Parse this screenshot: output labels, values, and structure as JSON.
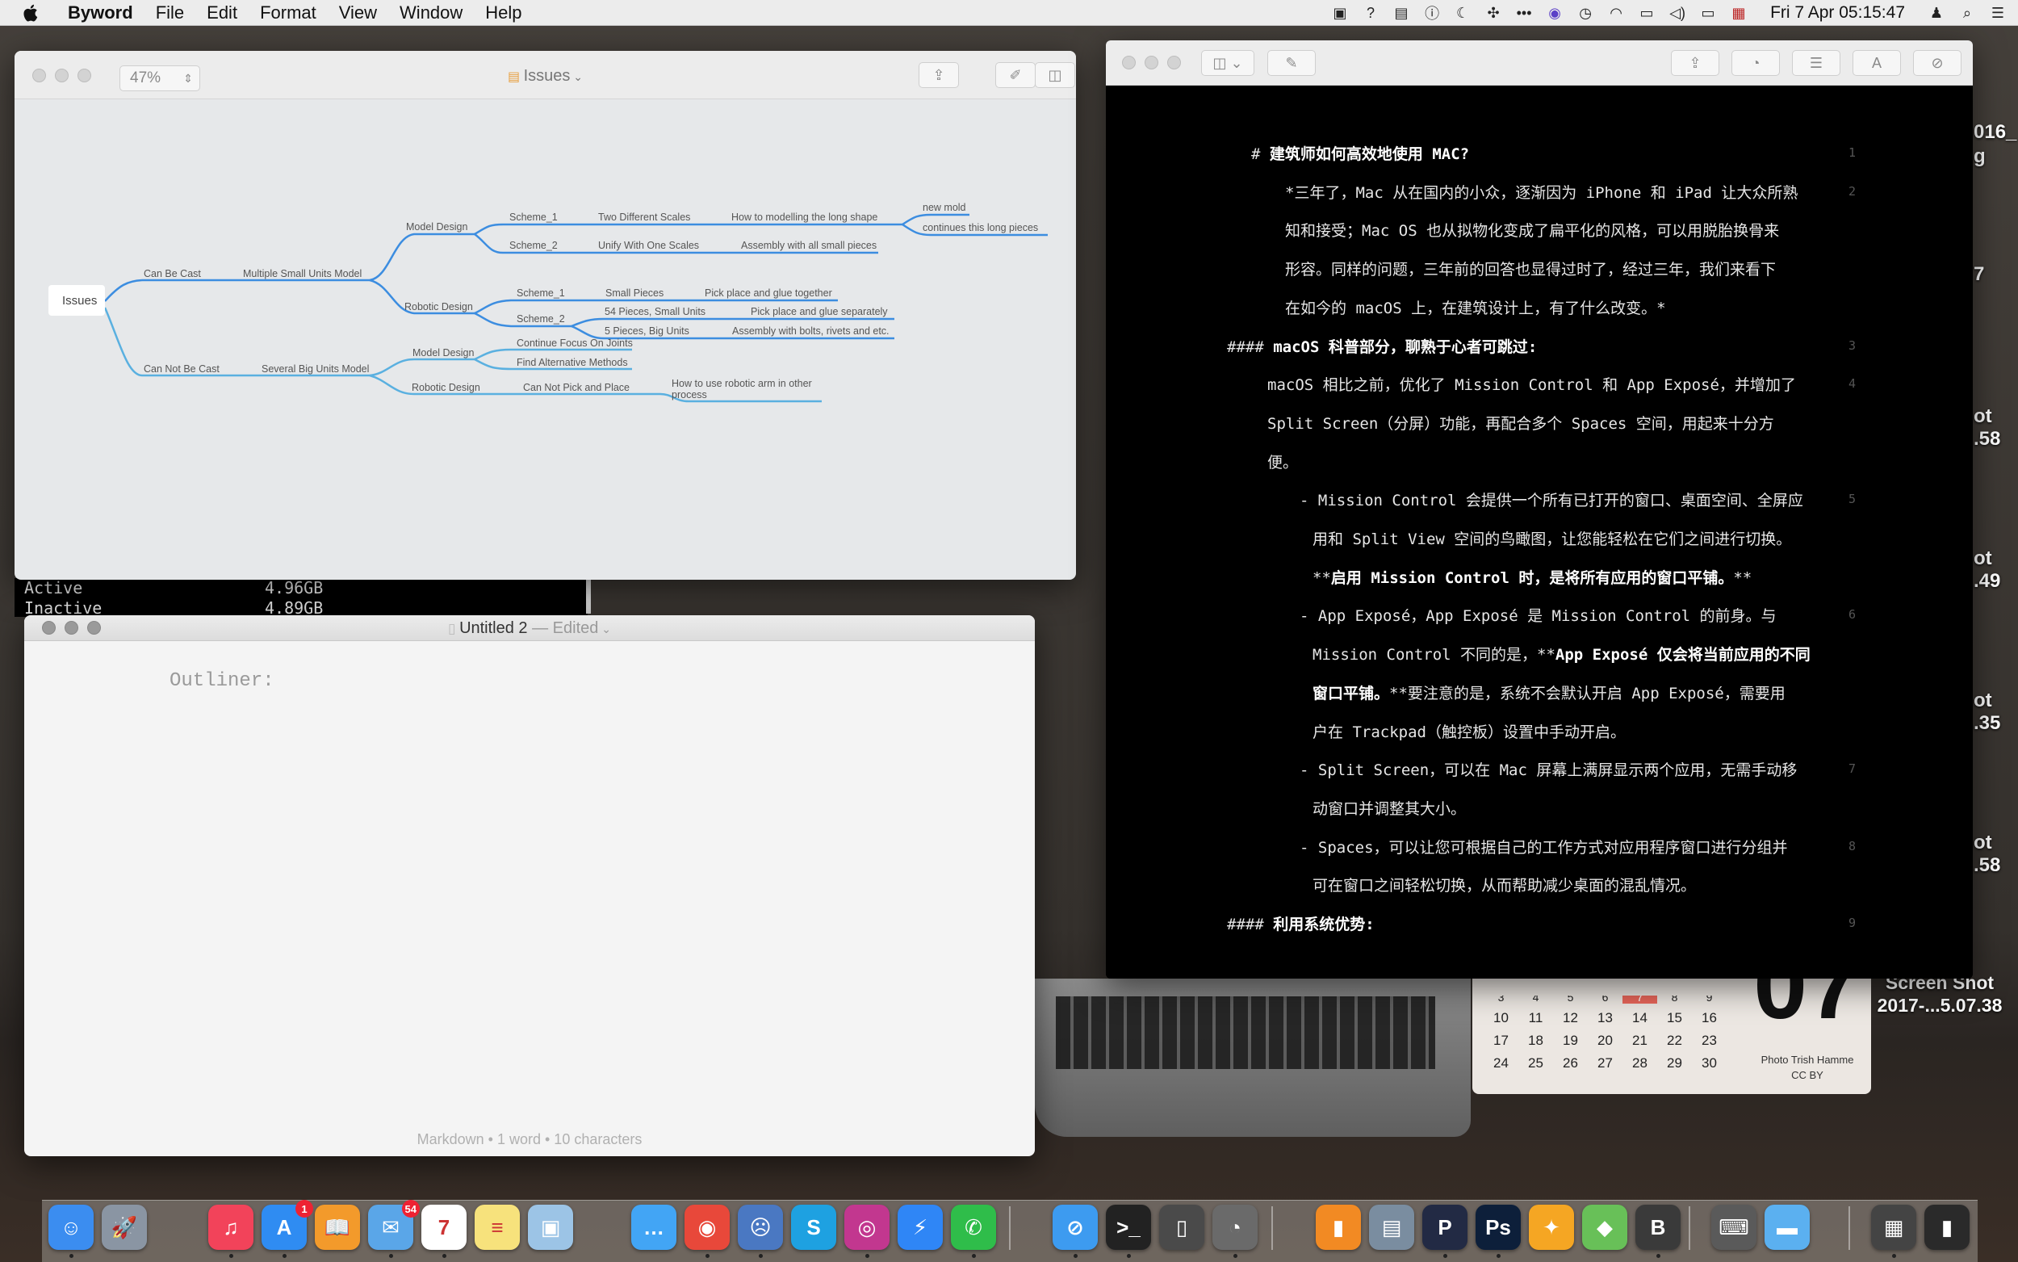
{
  "menubar": {
    "app_name": "Byword",
    "items": [
      "File",
      "Edit",
      "Format",
      "View",
      "Window",
      "Help"
    ],
    "clock": "Fri 7 Apr  05:15:47",
    "status_icons": [
      "bartender-icon",
      "question-icon",
      "battery-menu-icon",
      "info-icon",
      "moon-icon",
      "network-icon",
      "more-icon",
      "siri-icon",
      "time-machine-icon",
      "wifi-icon",
      "airplay-icon",
      "volume-icon",
      "battery-icon",
      "flag-us-icon",
      "user-icon",
      "search-icon",
      "list-icon"
    ]
  },
  "mindmap_window": {
    "zoom": "47%",
    "title": "Issues",
    "root": "Issues",
    "branches": {
      "can_be_cast": "Can Be Cast",
      "multiple_small": "Multiple Small Units Model",
      "model_design_1": "Model Design",
      "scheme_1a": "Scheme_1",
      "two_scales": "Two Different Scales",
      "how_long_shape": "How to modelling the long shape",
      "new_mold": "new mold",
      "continues": "continues this long pieces",
      "scheme_2a": "Scheme_2",
      "unify": "Unify With One Scales",
      "assembly_all": "Assembly with all small pieces",
      "robotic_design_1": "Robotic Design",
      "scheme_1b": "Scheme_1",
      "small_pieces": "Small Pieces",
      "pick_together": "Pick place and glue together",
      "scheme_2b": "Scheme_2",
      "fifty_four": "54 Pieces, Small Units",
      "pick_separately": "Pick place and glue separately",
      "five_pieces": "5 Pieces, Big Units",
      "assembly_bolts": "Assembly with bolts, rivets and etc.",
      "can_not_be_cast": "Can Not Be Cast",
      "several_big": "Several Big Units Model",
      "model_design_2": "Model Design",
      "continue_focus": "Continue Focus On Joints",
      "find_alt": "Find Alternative Methods",
      "robotic_design_2": "Robotic Design",
      "cannot_pick": "Can Not Pick and Place",
      "how_robotic_1": "How to use robotic arm in other",
      "how_robotic_2": "process"
    }
  },
  "terminal_behind": {
    "active_label": "Active",
    "active_value": "4.96GB",
    "inactive_label": "Inactive",
    "inactive_value": "4.89GB"
  },
  "editor_window": {
    "title": "Untitled 2",
    "edited": "— Edited",
    "body": "Outliner:",
    "status": "Markdown • 1 word • 10 characters"
  },
  "dark_editor": {
    "lines": [
      {
        "n": "1",
        "segs": [
          {
            "t": "# "
          },
          {
            "t": "建筑师如何高效地使用 MAC?",
            "b": true
          }
        ]
      },
      {
        "n": "2",
        "segs": [
          {
            "t": "*三年了，Mac 从在国内的小众，逐渐因为 iPhone 和 iPad 让大众所熟"
          }
        ]
      },
      {
        "n": "",
        "segs": [
          {
            "t": "知和接受；Mac OS 也从拟物化变成了扁平化的风格，可以用脱胎换骨来"
          }
        ]
      },
      {
        "n": "",
        "segs": [
          {
            "t": "形容。同样的问题，三年前的回答也显得过时了，经过三年，我们来看下"
          }
        ]
      },
      {
        "n": "",
        "segs": [
          {
            "t": "在如今的 macOS 上，在建筑设计上，有了什么改变。*"
          }
        ]
      },
      {
        "n": "3",
        "segs": [
          {
            "t": "#### "
          },
          {
            "t": "macOS 科普部分，聊熟于心者可跳过:",
            "b": true
          }
        ]
      },
      {
        "n": "4",
        "segs": [
          {
            "t": "macOS 相比之前，优化了 Mission Control 和 App Exposé，并增加了"
          }
        ]
      },
      {
        "n": "",
        "segs": [
          {
            "t": "Split Screen（分屏）功能，再配合多个 Spaces 空间，用起来十分方"
          }
        ]
      },
      {
        "n": "",
        "segs": [
          {
            "t": "便。"
          }
        ]
      },
      {
        "n": "5",
        "segs": [
          {
            "t": "- Mission Control 会提供一个所有已打开的窗口、桌面空间、全屏应"
          }
        ]
      },
      {
        "n": "",
        "segs": [
          {
            "t": "用和 Split View 空间的鸟瞰图，让您能轻松在它们之间进行切换。"
          }
        ]
      },
      {
        "n": "",
        "segs": [
          {
            "t": "**"
          },
          {
            "t": "启用 Mission Control 时，是将所有应用的窗口平铺。",
            "b": true
          },
          {
            "t": "**"
          }
        ]
      },
      {
        "n": "6",
        "segs": [
          {
            "t": "- App Exposé，App Exposé 是 Mission Control 的前身。与"
          }
        ]
      },
      {
        "n": "",
        "segs": [
          {
            "t": "Mission Control 不同的是，**"
          },
          {
            "t": "App Exposé 仅会将当前应用的不同",
            "b": true
          }
        ]
      },
      {
        "n": "",
        "segs": [
          {
            "t": "窗口平铺。",
            "b": true
          },
          {
            "t": "**要注意的是，系统不会默认开启 App Exposé，需要用"
          }
        ]
      },
      {
        "n": "",
        "segs": [
          {
            "t": "户在 Trackpad（触控板）设置中手动开启。"
          }
        ]
      },
      {
        "n": "7",
        "segs": [
          {
            "t": "- Split Screen，可以在 Mac 屏幕上满屏显示两个应用，无需手动移"
          }
        ]
      },
      {
        "n": "",
        "segs": [
          {
            "t": "动窗口并调整其大小。"
          }
        ]
      },
      {
        "n": "8",
        "segs": [
          {
            "t": "- Spaces，可以让您可根据自己的工作方式对应用程序窗口进行分组并"
          }
        ]
      },
      {
        "n": "",
        "segs": [
          {
            "t": "可在窗口之间轻松切换，从而帮助减少桌面的混乱情况。"
          }
        ]
      },
      {
        "n": "9",
        "segs": [
          {
            "t": "#### "
          },
          {
            "t": "利用系统优势:",
            "b": true
          }
        ]
      }
    ]
  },
  "desktop": {
    "right_labels": [
      "016_",
      "g",
      "7",
      "ot",
      ".58",
      "ot",
      ".49",
      "ot",
      ".35",
      "ot",
      ".58"
    ],
    "screenshot_label_1": "Screen Shot",
    "screenshot_label_2": "2017-...5.07.38",
    "calendar": {
      "rows": [
        [
          "3",
          "4",
          "5",
          "6",
          "7",
          "8",
          "9"
        ],
        [
          "10",
          "11",
          "12",
          "13",
          "14",
          "15",
          "16"
        ],
        [
          "17",
          "18",
          "19",
          "20",
          "21",
          "22",
          "23"
        ],
        [
          "24",
          "25",
          "26",
          "27",
          "28",
          "29",
          "30"
        ]
      ],
      "big_day": "07",
      "caption_1": "Photo Trish Hamme",
      "caption_2": "CC BY"
    }
  },
  "dock": {
    "items": [
      {
        "name": "finder-icon",
        "color": "#3b8df0",
        "glyph": "☺"
      },
      {
        "name": "launchpad-icon",
        "color": "#8a95a3",
        "glyph": "🚀"
      },
      {
        "name": "music-icon",
        "color": "#f2435a",
        "glyph": "♫"
      },
      {
        "name": "app-store-icon",
        "color": "#2f8cf2",
        "glyph": "A",
        "badge": "1"
      },
      {
        "name": "books-icon",
        "color": "#f39a2b",
        "glyph": "📖"
      },
      {
        "name": "mail-icon",
        "color": "#5aa6e8",
        "glyph": "✉",
        "badge": "54"
      },
      {
        "name": "calendar-icon",
        "color": "#ffffff",
        "glyph": "7"
      },
      {
        "name": "notes-icon",
        "color": "#f7e27c",
        "glyph": "≡"
      },
      {
        "name": "preview-icon",
        "color": "#9cc4e6",
        "glyph": "▣"
      },
      {
        "name": "messages-icon",
        "color": "#42a5f5",
        "glyph": "…"
      },
      {
        "name": "weibo-icon",
        "color": "#e8483a",
        "glyph": "◉"
      },
      {
        "name": "scream-icon",
        "color": "#4a78c2",
        "glyph": "☹"
      },
      {
        "name": "skype-icon",
        "color": "#1ea1e1",
        "glyph": "S"
      },
      {
        "name": "instagram-icon",
        "color": "#c2378f",
        "glyph": "◎"
      },
      {
        "name": "messenger-icon",
        "color": "#2f86f6",
        "glyph": "⚡"
      },
      {
        "name": "whatsapp-icon",
        "color": "#2fbd4a",
        "glyph": "✆"
      },
      {
        "name": "safari-icon",
        "color": "#3d9bf0",
        "glyph": "⊘"
      },
      {
        "name": "terminal-icon",
        "color": "#222222",
        "glyph": ">_"
      },
      {
        "name": "iphone-icon",
        "color": "#4a4a4a",
        "glyph": "▯"
      },
      {
        "name": "disk-utility-icon",
        "color": "#6a6a6a",
        "glyph": "◔"
      },
      {
        "name": "audio-icon",
        "color": "#f28a23",
        "glyph": "▮"
      },
      {
        "name": "image-capture-icon",
        "color": "#7a8da0",
        "glyph": "▤"
      },
      {
        "name": "pixelmator-icon",
        "color": "#222a44",
        "glyph": "P"
      },
      {
        "name": "photoshop-icon",
        "color": "#0d1f3a",
        "glyph": "Ps"
      },
      {
        "name": "tes-icon",
        "color": "#f5a623",
        "glyph": "✦"
      },
      {
        "name": "maps-icon",
        "color": "#68c058",
        "glyph": "◆"
      },
      {
        "name": "byword-icon",
        "color": "#3a3a3a",
        "glyph": "B"
      },
      {
        "name": "keyboard-icon",
        "color": "#5a5a5a",
        "glyph": "⌨"
      },
      {
        "name": "folder-icon",
        "color": "#5bb0f0",
        "glyph": "▬"
      },
      {
        "name": "keyboard-viewer-icon",
        "color": "#444444",
        "glyph": "▦"
      },
      {
        "name": "trash-icon",
        "color": "#2a2a2a",
        "glyph": "▮"
      }
    ]
  }
}
